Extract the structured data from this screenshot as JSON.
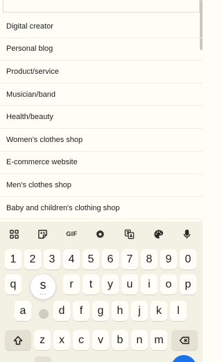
{
  "categories": [
    "Digital creator",
    "Personal blog",
    "Product/service",
    "Musician/band",
    "Health/beauty",
    "Women's clothes shop",
    "E-commerce website",
    "Men's clothes shop",
    "Baby and children's clothing shop"
  ],
  "keyboard": {
    "toolbar": {
      "gif_label": "GIF",
      "icons": [
        "apps-grid-icon",
        "sticker-icon",
        "gif-icon",
        "settings-gear-icon",
        "translate-icon",
        "palette-icon",
        "microphone-icon"
      ]
    },
    "numbers": [
      "1",
      "2",
      "3",
      "4",
      "5",
      "6",
      "7",
      "8",
      "9",
      "0"
    ],
    "row1": [
      "q",
      "s",
      "r",
      "t",
      "y",
      "u",
      "i",
      "o",
      "p"
    ],
    "row2": [
      "a",
      "d",
      "f",
      "g",
      "h",
      "j",
      "k",
      "l"
    ],
    "row3": [
      "z",
      "x",
      "c",
      "v",
      "b",
      "n",
      "m"
    ],
    "popup": {
      "letter": "s",
      "more_indicator": "..."
    },
    "icons": {
      "shift": "shift-arrow-icon",
      "backspace": "backspace-icon"
    },
    "accent_color": "#1a73e8"
  }
}
